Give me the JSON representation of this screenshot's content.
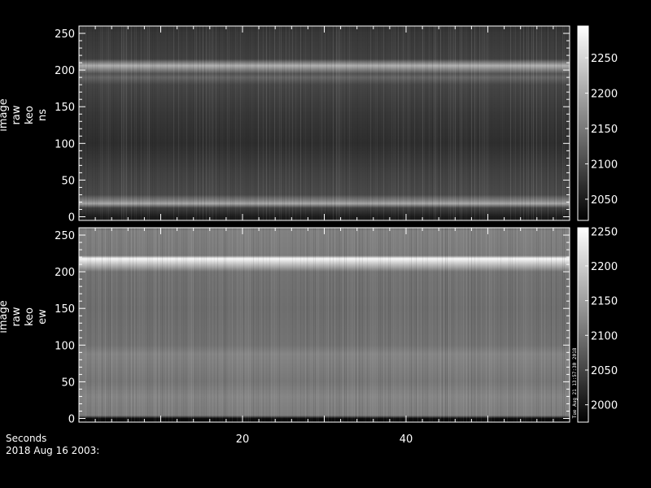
{
  "chart_data": [
    {
      "type": "heatmap",
      "ylabel": [
        "image",
        "raw",
        "keo",
        "ns"
      ],
      "xlim": [
        0,
        60
      ],
      "ylim": [
        -5,
        260
      ],
      "yticks": [
        0,
        50,
        100,
        150,
        200,
        250
      ],
      "colorbar": {
        "ticks": [
          2050,
          2100,
          2150,
          2200,
          2250
        ],
        "range": [
          2020,
          2295
        ]
      },
      "base_level": 2075,
      "profile": [
        {
          "y": 0,
          "value": 2050
        },
        {
          "y": 12,
          "value": 2090
        },
        {
          "y": 18,
          "value": 2200
        },
        {
          "y": 22,
          "value": 2160
        },
        {
          "y": 30,
          "value": 2100
        },
        {
          "y": 60,
          "value": 2090
        },
        {
          "y": 100,
          "value": 2070
        },
        {
          "y": 140,
          "value": 2080
        },
        {
          "y": 180,
          "value": 2095
        },
        {
          "y": 190,
          "value": 2130
        },
        {
          "y": 195,
          "value": 2110
        },
        {
          "y": 206,
          "value": 2210
        },
        {
          "y": 215,
          "value": 2090
        },
        {
          "y": 250,
          "value": 2080
        },
        {
          "y": 256,
          "value": 2075
        }
      ]
    },
    {
      "type": "heatmap",
      "ylabel": [
        "image",
        "raw",
        "keo",
        "ew"
      ],
      "xlim": [
        0,
        60
      ],
      "ylim": [
        -5,
        260
      ],
      "yticks": [
        0,
        50,
        100,
        150,
        200,
        250
      ],
      "colorbar": {
        "ticks": [
          2000,
          2050,
          2100,
          2150,
          2200,
          2250
        ],
        "range": [
          1975,
          2255
        ],
        "annotation": "Tue Aug 21 13:57:30 2018"
      },
      "base_level": 2095,
      "profile": [
        {
          "y": 0,
          "value": 1985
        },
        {
          "y": 4,
          "value": 2110
        },
        {
          "y": 30,
          "value": 2120
        },
        {
          "y": 50,
          "value": 2105
        },
        {
          "y": 88,
          "value": 2120
        },
        {
          "y": 100,
          "value": 2100
        },
        {
          "y": 150,
          "value": 2095
        },
        {
          "y": 200,
          "value": 2100
        },
        {
          "y": 218,
          "value": 2250
        },
        {
          "y": 222,
          "value": 2110
        },
        {
          "y": 256,
          "value": 2115
        }
      ]
    }
  ],
  "xaxis": {
    "label": "Seconds",
    "ticks": [
      20,
      40
    ],
    "xlim": [
      0,
      60
    ]
  },
  "footer": "2018 Aug 16 2003:"
}
